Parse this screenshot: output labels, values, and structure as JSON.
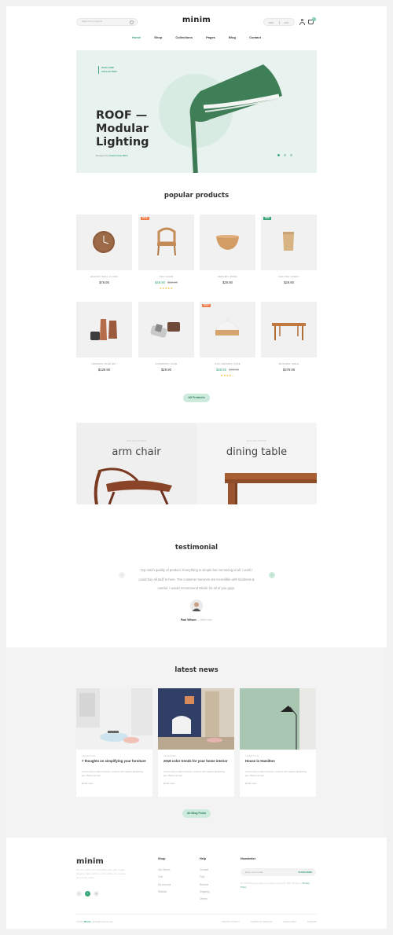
{
  "header": {
    "search_placeholder": "Search for products",
    "logo": "minim",
    "lang": [
      "ENG",
      "USD"
    ],
    "cart_count": "0"
  },
  "nav": [
    "Home",
    "Shop",
    "Collections",
    "Pages",
    "Blog",
    "Contact"
  ],
  "hero": {
    "tagline": [
      "2018 LAMP",
      "COLLECTION"
    ],
    "title": "ROOF —\nModular\nLighting",
    "designed_prefix": "Designed by",
    "designer": "Doinnstruz Wire"
  },
  "popular": {
    "title": "popular products",
    "products": [
      {
        "name": "WALNUT WALL CLOCK",
        "price": "$79.90"
      },
      {
        "name": "OAK CHAIR",
        "badge": "SALE",
        "price": "$49.90",
        "old_price": "$59.90",
        "stars": "★★★★★"
      },
      {
        "name": "CERAMIC BOWL",
        "price": "$29.90"
      },
      {
        "name": "OAK TEA CADDY",
        "badge": "NEW",
        "price": "$29.90"
      },
      {
        "name": "CERAMIC VASE SET",
        "price": "$129.90"
      },
      {
        "name": "SUPERMINI CASE",
        "price": "$29.90"
      },
      {
        "name": "OAK CERAMIC CASE",
        "badge": "SALE",
        "price": "$39.90",
        "old_price": "$49.90",
        "stars": "★★★★☆"
      },
      {
        "name": "WOODEN TABLE",
        "price": "$379.90"
      }
    ],
    "all_button": "All Products"
  },
  "categories": [
    {
      "sub": "COLLECTIONS",
      "name": "arm chair"
    },
    {
      "sub": "COLLECTIONS",
      "name": "dining table"
    }
  ],
  "testimonial": {
    "title": "testimonial",
    "quote": "Top notch quality of product. Everything is simple but not boring at all. I wish I could buy all stuff in here. The customer services are incredible with kindness & careful. I would recommend Minim for all of you guys.",
    "author": "Paul Wilson",
    "role": "Web user"
  },
  "news": {
    "title": "latest news",
    "posts": [
      {
        "tag": "LIFESTYLE",
        "title": "7 thoughts on simplifying your furniture",
        "excerpt": "Lorem ipsum dolor sit amet, consect etur sapien adipiscing elit. Mauris sit nec.",
        "more": "Read more"
      },
      {
        "tag": "INTERIOR",
        "title": "2018 color trends for your home interior",
        "excerpt": "Lorem ipsum dolor sit amet, consect etur sapien adipiscing elit. Mauris sit nec.",
        "more": "Read more"
      },
      {
        "tag": "LIFESTYLE",
        "title": "House in Hamilton",
        "excerpt": "Lorem ipsum dolor sit amet, consect etur sapien adipiscing elit. Mauris sit nec.",
        "more": "Read more"
      }
    ],
    "all_button": "All Blog Posts"
  },
  "footer": {
    "logo": "minim",
    "about": "We are minim, the minimalist store with unique designs. Made with love from different countries around the world.",
    "social": [
      "f",
      "t",
      "ig"
    ],
    "shop_title": "Shop",
    "shop_links": [
      "Our Stores",
      "Cart",
      "My account",
      "Wishlist"
    ],
    "help_title": "Help",
    "help_links": [
      "Contact",
      "FAQ",
      "Returns",
      "Shipping",
      "Orders"
    ],
    "newsletter_title": "Newsletter",
    "newsletter_placeholder": "Enter your email",
    "newsletter_button": "SUBSCRIBE",
    "newsletter_note": "By subscribing you agree to receive news and offers. Read our",
    "newsletter_note_link": "Privacy Policy",
    "copyright_prefix": "©2018",
    "copyright_brand": "Minim",
    "copyright_suffix": ". All Rights Reserved.",
    "legal": [
      "PRIVACY POLICY",
      "TERMS OF SERVICE",
      "LEGAL INFO",
      "SITEMAP"
    ]
  },
  "colors": {
    "accent": "#3aa679",
    "hero_bg": "#e8f2ee",
    "sale": "#f07d4a",
    "new": "#3aa679"
  }
}
